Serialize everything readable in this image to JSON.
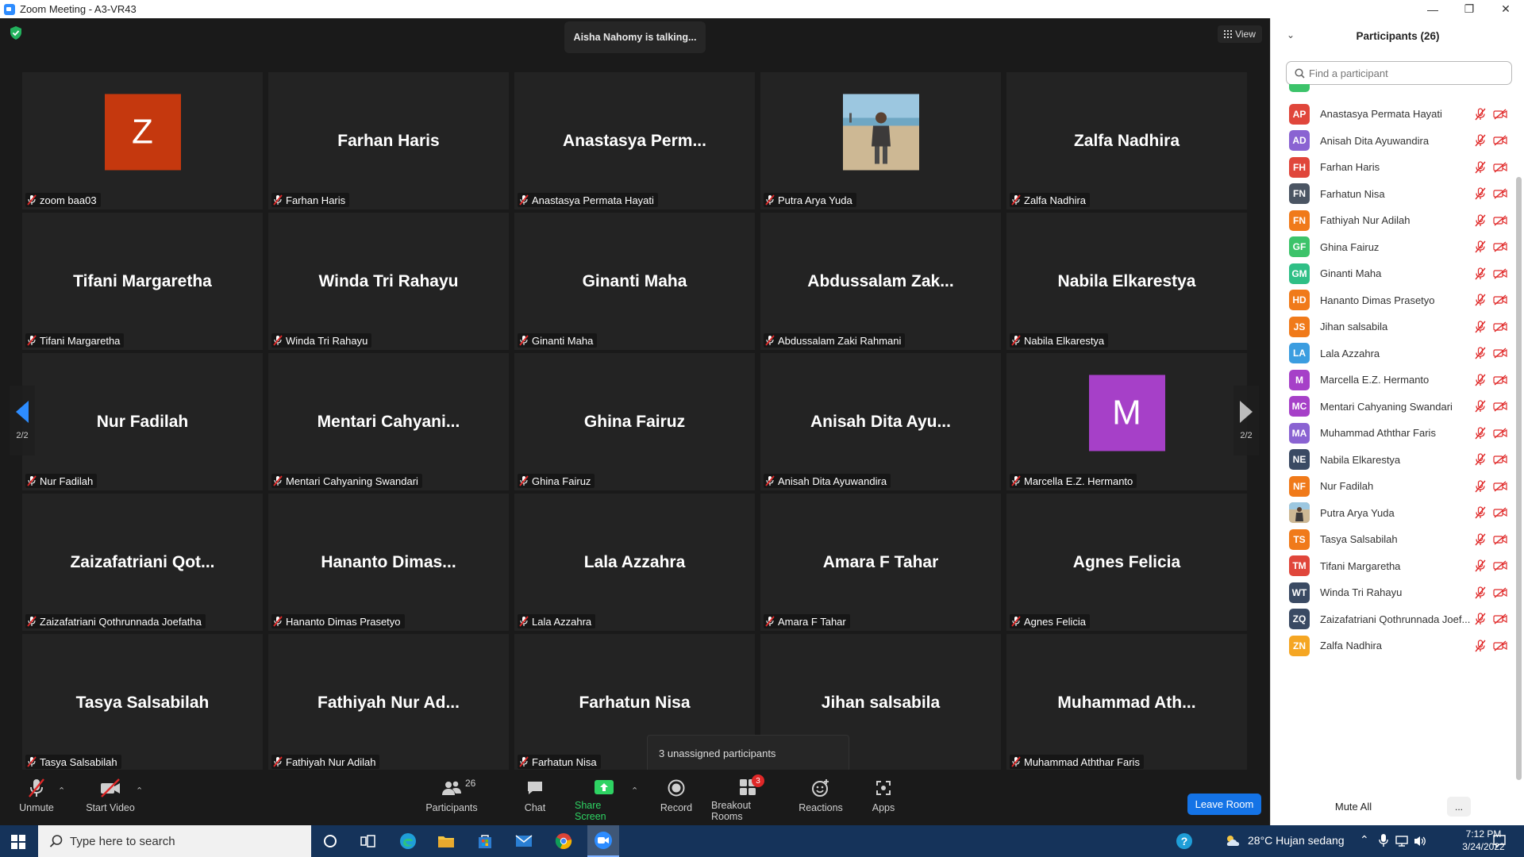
{
  "window": {
    "title": "Zoom Meeting - A3-VR43"
  },
  "meeting": {
    "talking": "Aisha Nahomy is talking...",
    "view_label": "View",
    "page_left": "2/2",
    "page_right": "2/2",
    "unassigned": "3 unassigned participants"
  },
  "tiles": [
    {
      "big": "",
      "label": "zoom baa03",
      "avatar": "Z",
      "avatar_color": "#c5380e"
    },
    {
      "big": "Farhan Haris",
      "label": "Farhan Haris"
    },
    {
      "big": "Anastasya  Perm...",
      "label": "Anastasya Permata Hayati"
    },
    {
      "big": "",
      "label": "Putra Arya Yuda",
      "photo": true
    },
    {
      "big": "Zalfa Nadhira",
      "label": "Zalfa Nadhira"
    },
    {
      "big": "Tifani Margaretha",
      "label": "Tifani Margaretha"
    },
    {
      "big": "Winda Tri Rahayu",
      "label": "Winda Tri Rahayu"
    },
    {
      "big": "Ginanti Maha",
      "label": "Ginanti Maha"
    },
    {
      "big": "Abdussalam  Zak...",
      "label": "Abdussalam Zaki Rahmani"
    },
    {
      "big": "Nabila Elkarestya",
      "label": "Nabila Elkarestya"
    },
    {
      "big": "Nur Fadilah",
      "label": "Nur Fadilah"
    },
    {
      "big": "Mentari  Cahyani...",
      "label": "Mentari Cahyaning Swandari"
    },
    {
      "big": "Ghina Fairuz",
      "label": "Ghina Fairuz"
    },
    {
      "big": "Anisah  Dita  Ayu...",
      "label": "Anisah Dita Ayuwandira"
    },
    {
      "big": "",
      "label": "Marcella E.Z. Hermanto",
      "avatar": "M",
      "avatar_color": "#a640c8"
    },
    {
      "big": "Zaizafatriani  Qot...",
      "label": "Zaizafatriani Qothrunnada Joefatha"
    },
    {
      "big": "Hananto  Dimas...",
      "label": "Hananto Dimas Prasetyo"
    },
    {
      "big": "Lala Azzahra",
      "label": "Lala Azzahra"
    },
    {
      "big": "Amara F Tahar",
      "label": "Amara F Tahar"
    },
    {
      "big": "Agnes Felicia",
      "label": "Agnes Felicia"
    },
    {
      "big": "Tasya Salsabilah",
      "label": "Tasya Salsabilah"
    },
    {
      "big": "Fathiyah  Nur  Ad...",
      "label": "Fathiyah Nur Adilah"
    },
    {
      "big": "Farhatun Nisa",
      "label": "Farhatun Nisa"
    },
    {
      "big": "Jihan salsabila",
      "label": ""
    },
    {
      "big": "Muhammad  Ath...",
      "label": "Muhammad Aththar Faris"
    }
  ],
  "toolbar": {
    "unmute": "Unmute",
    "start_video": "Start Video",
    "participants": "Participants",
    "participants_count": "26",
    "chat": "Chat",
    "share_screen": "Share Screen",
    "record": "Record",
    "breakout_rooms": "Breakout Rooms",
    "breakout_badge": "3",
    "reactions": "Reactions",
    "apps": "Apps",
    "leave": "Leave Room"
  },
  "panel": {
    "title": "Participants (26)",
    "search_placeholder": "Find a participant",
    "mute_all": "Mute All",
    "more": "...",
    "participants": [
      {
        "initials": "AP",
        "name": "Anastasya Permata Hayati",
        "color": "#e0463b"
      },
      {
        "initials": "AD",
        "name": "Anisah Dita Ayuwandira",
        "color": "#8a63d2"
      },
      {
        "initials": "FH",
        "name": "Farhan Haris",
        "color": "#e0463b"
      },
      {
        "initials": "FN",
        "name": "Farhatun Nisa",
        "color": "#4b5563"
      },
      {
        "initials": "FN",
        "name": "Fathiyah Nur Adilah",
        "color": "#f07a1a"
      },
      {
        "initials": "GF",
        "name": "Ghina Fairuz",
        "color": "#3cc36a"
      },
      {
        "initials": "GM",
        "name": "Ginanti Maha",
        "color": "#2fbf86"
      },
      {
        "initials": "HD",
        "name": "Hananto Dimas Prasetyo",
        "color": "#f07a1a"
      },
      {
        "initials": "JS",
        "name": "Jihan salsabila",
        "color": "#f07a1a"
      },
      {
        "initials": "LA",
        "name": "Lala Azzahra",
        "color": "#3b9de0"
      },
      {
        "initials": "M",
        "name": "Marcella E.Z. Hermanto",
        "color": "#a640c8"
      },
      {
        "initials": "MC",
        "name": "Mentari Cahyaning Swandari",
        "color": "#a640c8"
      },
      {
        "initials": "MA",
        "name": "Muhammad Aththar Faris",
        "color": "#8a63d2"
      },
      {
        "initials": "NE",
        "name": "Nabila Elkarestya",
        "color": "#3a4a63"
      },
      {
        "initials": "NF",
        "name": "Nur Fadilah",
        "color": "#f07a1a"
      },
      {
        "initials": "",
        "name": "Putra Arya Yuda",
        "color": "#a89a84",
        "photo": true
      },
      {
        "initials": "TS",
        "name": "Tasya Salsabilah",
        "color": "#f07a1a"
      },
      {
        "initials": "TM",
        "name": "Tifani Margaretha",
        "color": "#e0463b"
      },
      {
        "initials": "WT",
        "name": "Winda Tri Rahayu",
        "color": "#3a4a63"
      },
      {
        "initials": "ZQ",
        "name": "Zaizafatriani Qothrunnada Joef...",
        "color": "#3a4a63"
      },
      {
        "initials": "ZN",
        "name": "Zalfa Nadhira",
        "color": "#f5a623"
      }
    ]
  },
  "taskbar": {
    "search_placeholder": "Type here to search",
    "weather": "28°C  Hujan sedang",
    "time": "7:12 PM",
    "date": "3/24/2022"
  },
  "colors": {
    "accent": "#2d8cff",
    "leave": "#1473e6",
    "muted_red": "#e02828",
    "share_green": "#2ed363"
  }
}
